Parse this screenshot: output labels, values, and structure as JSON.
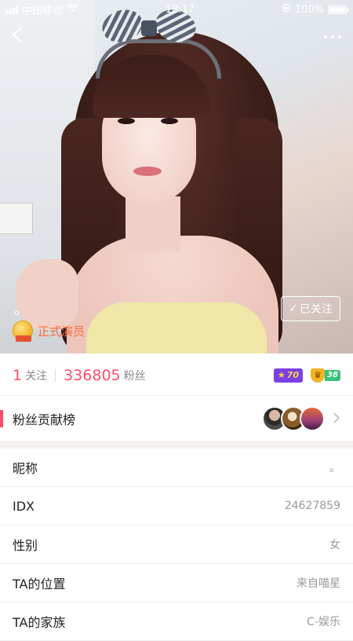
{
  "status_bar": {
    "carrier": "中国移动",
    "time": "18:17",
    "battery": "100%",
    "battery_level": 1.0
  },
  "profile": {
    "display_name": "。",
    "follow_button": "已关注",
    "follow_check": "✓",
    "badge_label": "正式演员"
  },
  "stats": {
    "following_count": "1",
    "following_label": "关注",
    "fans_count": "336805",
    "fans_label": "粉丝",
    "star_level": "70",
    "crown_level": "38"
  },
  "fan_rank": {
    "title": "粉丝贡献榜"
  },
  "info_rows": [
    {
      "label": "昵称",
      "value": "。"
    },
    {
      "label": "IDX",
      "value": "24627859"
    },
    {
      "label": "性别",
      "value": "女"
    },
    {
      "label": "TA的位置",
      "value": "来自喵星"
    },
    {
      "label": "TA的家族",
      "value": "C-娱乐"
    }
  ],
  "icons": {
    "back": "chevron-left-icon",
    "more": "more-dots-icon",
    "fan_rank_arrow": "chevron-right-icon"
  },
  "colors": {
    "accent_pink": "#ff4d6a",
    "badge_orange": "#ff6a3d",
    "star_purple": "#7b3fe4",
    "crown_green": "#37c27a"
  }
}
